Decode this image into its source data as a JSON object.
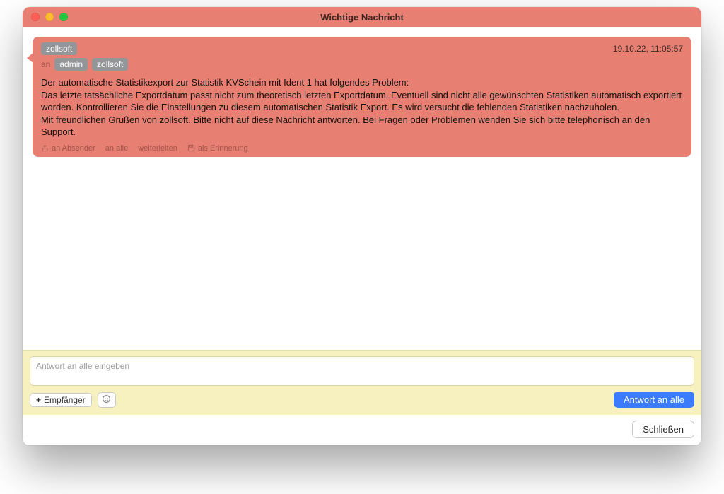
{
  "window": {
    "title": "Wichtige Nachricht"
  },
  "message": {
    "from": "zollsoft",
    "to_label": "an",
    "to": [
      "admin",
      "zollsoft"
    ],
    "timestamp": "19.10.22, 11:05:57",
    "body": "Der automatische Statistikexport zur Statistik KVSchein mit Ident 1 hat folgendes Problem:\nDas letzte tatsächliche Exportdatum passt nicht zum theoretisch letzten Exportdatum. Eventuell sind nicht alle gewünschten Statistiken automatisch exportiert worden. Kontrollieren Sie die Einstellungen zu diesem automatischen Statistik Export. Es wird versucht die fehlenden Statistiken nachzuholen.\nMit freundlichen Grüßen von zollsoft. Bitte nicht auf diese Nachricht antworten. Bei Fragen oder Problemen wenden Sie sich bitte telephonisch an den Support.",
    "actions": {
      "reply_sender": "an Absender",
      "reply_all": "an alle",
      "forward": "weiterleiten",
      "as_reminder": "als Erinnerung"
    }
  },
  "reply": {
    "placeholder": "Antwort an alle eingeben",
    "add_recipient": "Empfänger",
    "send_all": "Antwort an alle"
  },
  "footer": {
    "close": "Schließen"
  },
  "icons": {
    "share": "share-icon",
    "save": "save-icon",
    "plus": "plus-icon",
    "emoji": "emoji-icon"
  }
}
